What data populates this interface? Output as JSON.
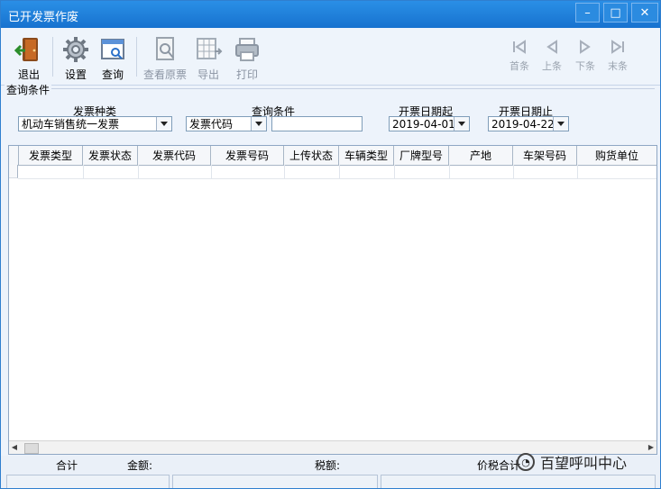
{
  "window": {
    "title": "已开发票作废"
  },
  "window_controls": {
    "minimize": "–",
    "maximize": "□",
    "close": "✕"
  },
  "toolbar": {
    "exit_label": "退出",
    "settings_label": "设置",
    "query_label": "查询",
    "view_original_label": "查看原票",
    "export_label": "导出",
    "print_label": "打印",
    "first_label": "首条",
    "previous_label": "上条",
    "next_label": "下条",
    "last_label": "末条"
  },
  "query": {
    "section_title": "查询条件",
    "invoice_type_label": "发票种类",
    "invoice_type_value": "机动车销售统一发票",
    "condition_label": "查询条件",
    "condition_value": "发票代码",
    "condition_text": "",
    "start_date_label": "开票日期起",
    "start_date_value": "2019-04-01",
    "end_date_label": "开票日期止",
    "end_date_value": "2019-04-22"
  },
  "table": {
    "columns": [
      "发票类型",
      "发票状态",
      "发票代码",
      "发票号码",
      "上传状态",
      "车辆类型",
      "厂牌型号",
      "产地",
      "车架号码",
      "购货单位"
    ]
  },
  "status": {
    "total_label": "合计",
    "amount_label": "金额:",
    "tax_label": "税额:",
    "price_tax_label": "价税合计"
  },
  "watermark": {
    "text": "百望呼叫中心"
  }
}
